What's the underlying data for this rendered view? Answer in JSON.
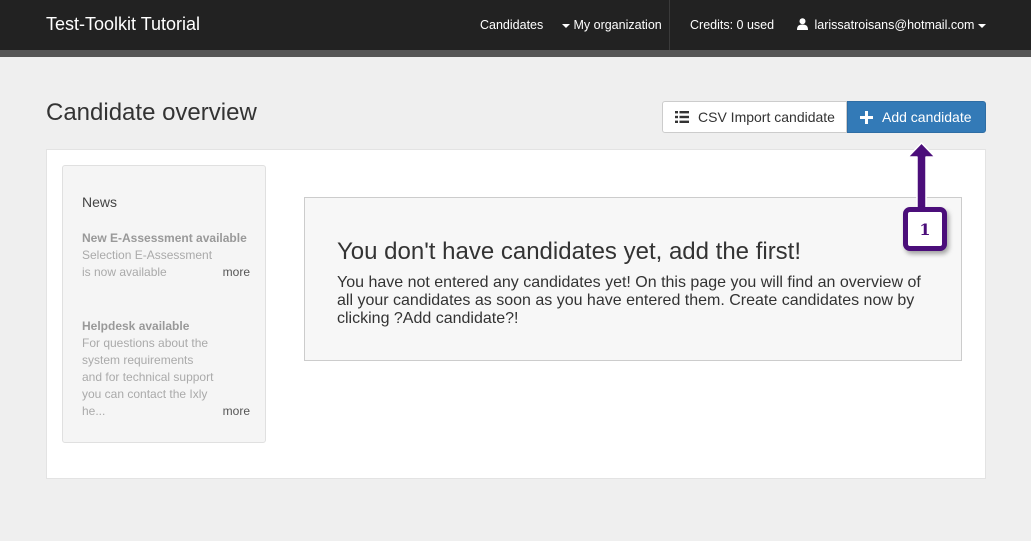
{
  "navbar": {
    "brand": "Test-Toolkit Tutorial",
    "candidates": "Candidates",
    "my_organization": "My organization",
    "credits": "Credits: 0 used",
    "user_email": "larissatroisans@hotmail.com"
  },
  "page": {
    "title": "Candidate overview"
  },
  "toolbar": {
    "csv_import_label": "CSV Import candidate",
    "add_candidate_label": "Add candidate",
    "accent_color": "#337ab7"
  },
  "news": {
    "title": "News",
    "items": [
      {
        "title": "New E-Assessment available",
        "text": "Selection E-Assessment is now available",
        "more": "more"
      },
      {
        "title": "Helpdesk available",
        "text": "For questions about the system requirements and for technical support you can contact the Ixly he...",
        "more": "more"
      }
    ]
  },
  "empty_state": {
    "title": "You don't have candidates yet, add the first!",
    "text": "You have not entered any candidates yet! On this page you will find an overview of all your candidates as soon as you have entered them. Create candidates now by clicking ?Add candidate?!"
  },
  "annotation": {
    "step_number": "1",
    "color": "#4b0e7a"
  },
  "icons": {
    "user": "user-icon",
    "list": "list-icon",
    "plus": "plus-icon"
  }
}
